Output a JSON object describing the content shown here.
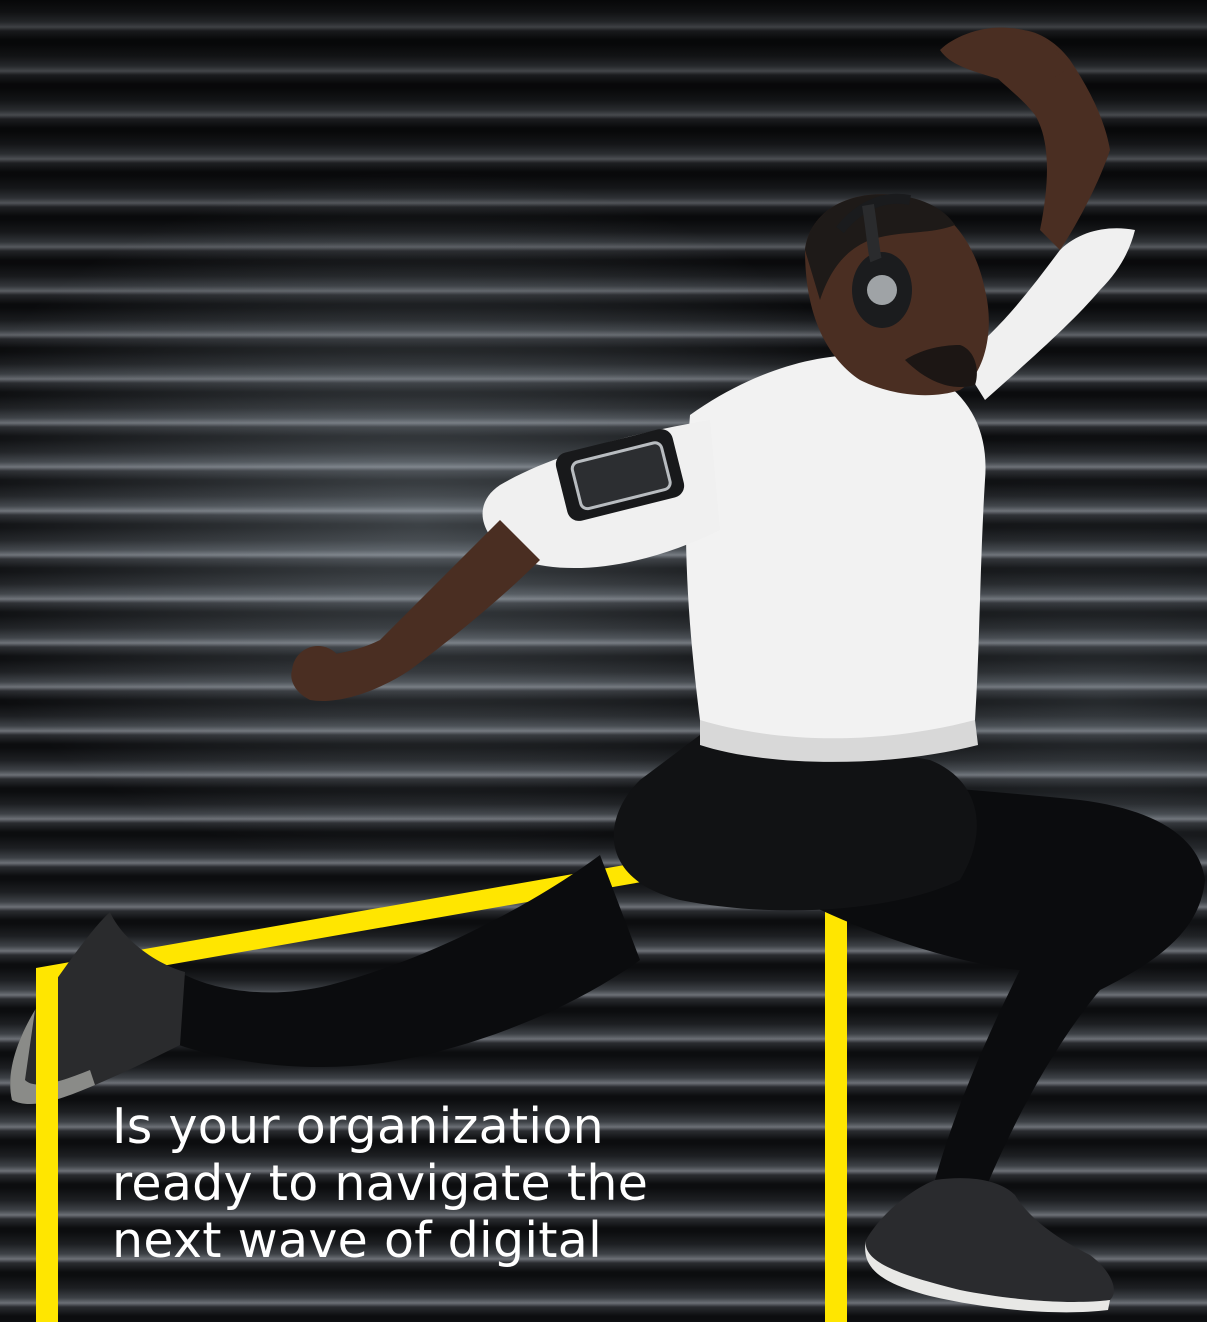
{
  "photo": {
    "subject": "jumping-runner",
    "background": "roller-shutter"
  },
  "frame": {
    "color": "#FFE600"
  },
  "headline": {
    "text": "Is your organization\nready to navigate the\nnext wave of digital"
  }
}
